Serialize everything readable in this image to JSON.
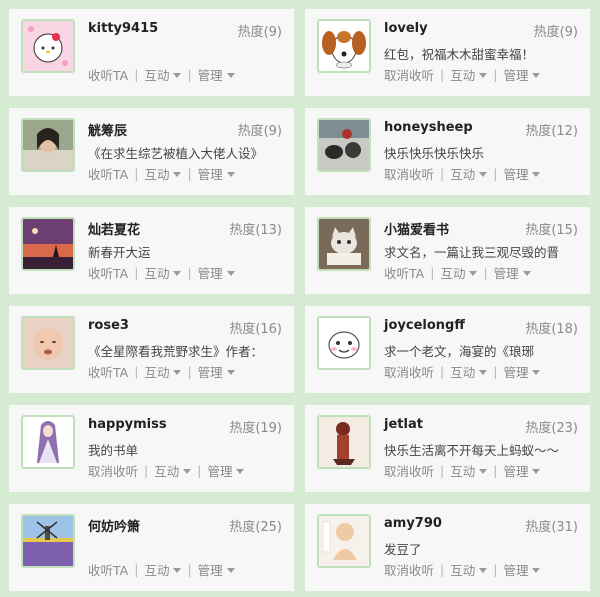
{
  "labels": {
    "heat_prefix": "热度",
    "follow": "收听TA",
    "unfollow": "取消收听",
    "interact": "互动",
    "manage": "管理",
    "separator": "|"
  },
  "users": [
    {
      "name": "kitty9415",
      "heat": "热度(9)",
      "signature": "",
      "follow_label": "收听TA",
      "avatar": "hello-kitty-avatar"
    },
    {
      "name": "lovely",
      "heat": "热度(9)",
      "signature": "红包，祝福木木甜蜜幸福！",
      "follow_label": "取消收听",
      "avatar": "dog-avatar"
    },
    {
      "name": "觥筹辰",
      "heat": "热度(9)",
      "signature": "《在求生综艺被植入大佬人设》",
      "follow_label": "收听TA",
      "avatar": "costume-actor-avatar"
    },
    {
      "name": "honeysheep",
      "heat": "热度(12)",
      "signature": "快乐快乐快乐快乐",
      "follow_label": "取消收听",
      "avatar": "dog-photo-avatar"
    },
    {
      "name": "灿若夏花",
      "heat": "热度(13)",
      "signature": "新春开大运",
      "follow_label": "收听TA",
      "avatar": "sunset-avatar"
    },
    {
      "name": "小猫爱看书",
      "heat": "热度(15)",
      "signature": "求文名，一篇让我三观尽毁的晋",
      "follow_label": "收听TA",
      "avatar": "cat-book-avatar"
    },
    {
      "name": "rose3",
      "heat": "热度(16)",
      "signature": "《全星際看我荒野求生》作者：",
      "follow_label": "收听TA",
      "avatar": "baby-avatar"
    },
    {
      "name": "joycelongff",
      "heat": "热度(18)",
      "signature": "求一个老文，海宴的《琅琊",
      "follow_label": "取消收听",
      "avatar": "cartoon-avatar"
    },
    {
      "name": "happymiss",
      "heat": "热度(19)",
      "signature": "我的书单",
      "follow_label": "取消收听",
      "avatar": "anime-girl-avatar"
    },
    {
      "name": "jetlat",
      "heat": "热度(23)",
      "signature": "快乐生活离不开每天上蚂蚁～～",
      "follow_label": "取消收听",
      "avatar": "illustration-avatar"
    },
    {
      "name": "何妨吟箫",
      "heat": "热度(25)",
      "signature": "",
      "follow_label": "收听TA",
      "avatar": "windmill-avatar"
    },
    {
      "name": "amy790",
      "heat": "热度(31)",
      "signature": "发豆了",
      "follow_label": "取消收听",
      "avatar": "monk-avatar"
    }
  ],
  "colors": {
    "page_background": "#d6ecd2",
    "card_background": "#f6f7f6",
    "avatar_border": "#bfe0bb",
    "muted_text": "#8a8a8a"
  }
}
